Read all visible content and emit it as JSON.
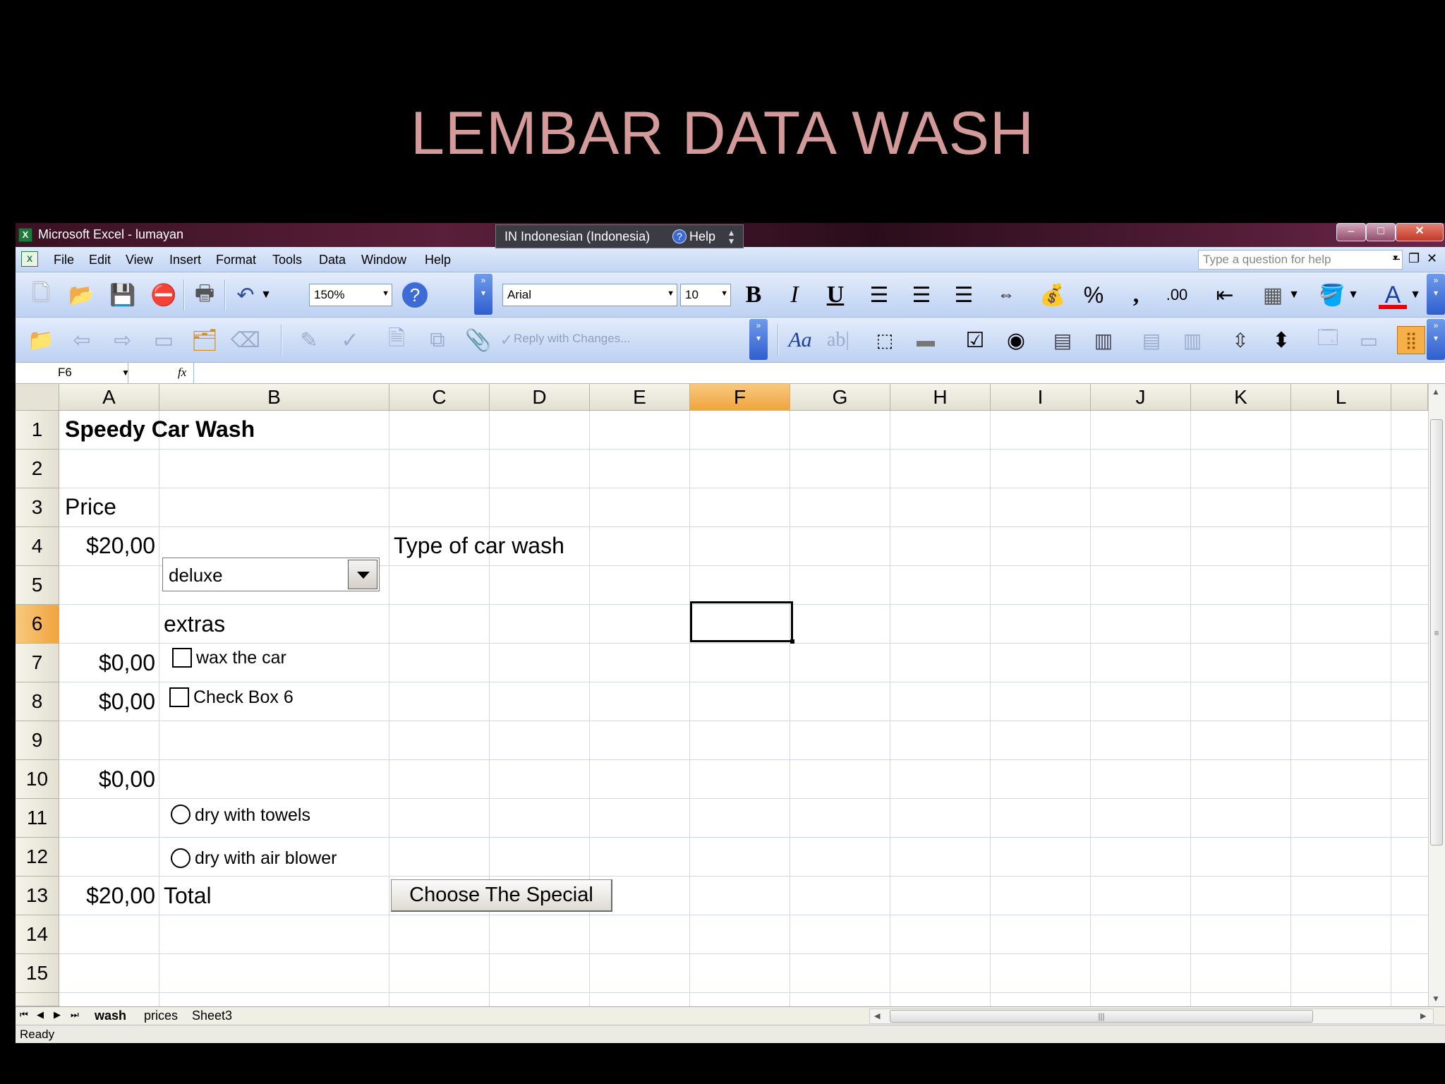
{
  "slide": {
    "title": "LEMBAR DATA WASH"
  },
  "window": {
    "app_title": "Microsoft Excel - lumayan",
    "language_bar": {
      "language": "IN Indonesian (Indonesia)",
      "help": "Help"
    },
    "controls": {
      "minimize": "–",
      "maximize": "□",
      "close": "✕"
    }
  },
  "menu": {
    "items": [
      "File",
      "Edit",
      "View",
      "Insert",
      "Format",
      "Tools",
      "Data",
      "Window",
      "Help"
    ],
    "help_placeholder": "Type a question for help"
  },
  "toolbar": {
    "zoom": "150%",
    "font_name": "Arial",
    "font_size": "10",
    "bold": "B",
    "italic": "I",
    "underline": "U",
    "percent": "%",
    "comma": ",",
    "reply_with_changes": "Reply with Changes..."
  },
  "formula_bar": {
    "name_box": "F6",
    "fx": "fx",
    "formula": ""
  },
  "grid": {
    "columns": [
      "A",
      "B",
      "C",
      "D",
      "E",
      "F",
      "G",
      "H",
      "I",
      "J",
      "K",
      "L"
    ],
    "active_column": "F",
    "rows": [
      "1",
      "2",
      "3",
      "4",
      "5",
      "6",
      "7",
      "8",
      "9",
      "10",
      "11",
      "12",
      "13",
      "14",
      "15"
    ],
    "active_row": "6",
    "cells": {
      "A1": "Speedy Car Wash",
      "A3": "Price",
      "A4": "$20,00",
      "C4": "Type of car wash",
      "B6": "extras",
      "A7": "$0,00",
      "A8": "$0,00",
      "A10": "$0,00",
      "A13": "$20,00",
      "B13": "Total"
    },
    "selected_cell": "F6"
  },
  "controls": {
    "wash_type_combo": "deluxe",
    "checkbox_wax": "wax the car",
    "checkbox_6": "Check Box 6",
    "radio_towels": "dry with towels",
    "radio_blower": "dry with air blower",
    "special_button": "Choose The Special"
  },
  "sheets": {
    "tabs": [
      "wash",
      "prices",
      "Sheet3"
    ],
    "active": "wash"
  },
  "status": {
    "text": "Ready"
  }
}
